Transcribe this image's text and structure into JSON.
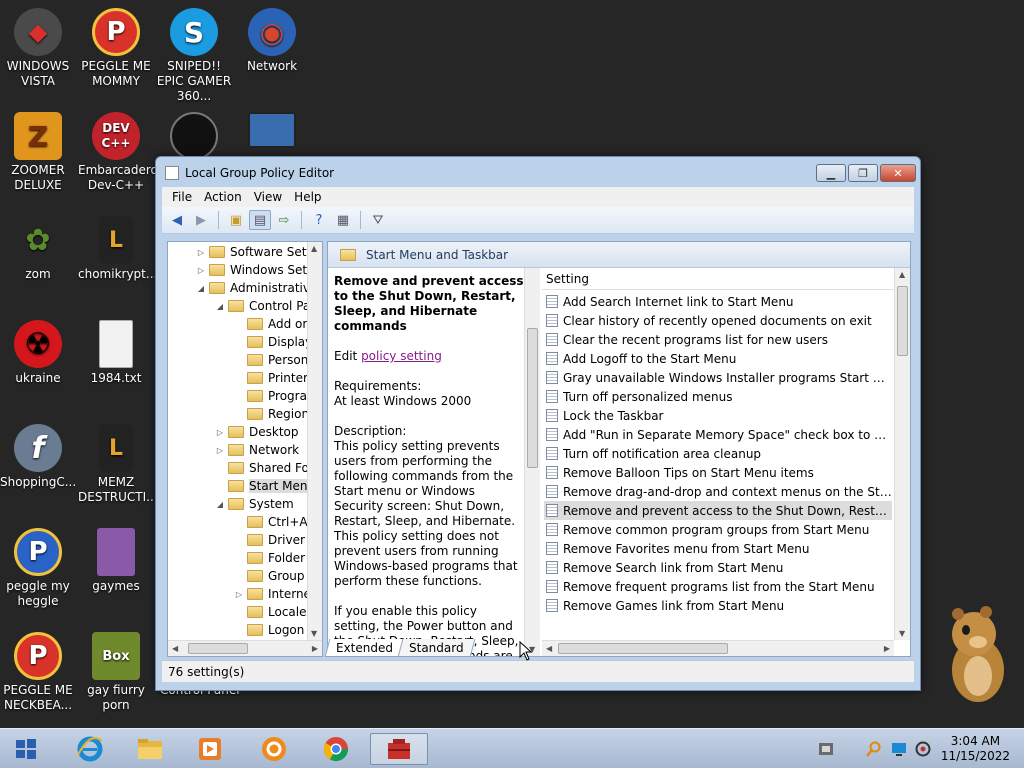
{
  "desktop": {
    "icons": [
      {
        "label": "WINDOWS VISTA",
        "icon": "windows-vista-icon",
        "color": "#4a4a4a"
      },
      {
        "label": "PEGGLE ME MOMMY",
        "icon": "peggle-icon",
        "color": "#d9322a"
      },
      {
        "label": "SNIPED!! EPIC GAMER 360...",
        "icon": "skype-icon",
        "color": "#1b9be0"
      },
      {
        "label": "Network",
        "icon": "network-icon",
        "color": "#2a63b5"
      },
      {
        "label": "ZOOMER DELUXE",
        "icon": "zoomer-icon",
        "color": "#e0951c"
      },
      {
        "label": "Embarcadero Dev-C++",
        "icon": "devcpp-icon",
        "color": "#c2222a"
      },
      {
        "label": "",
        "icon": "dark-circle-icon",
        "color": "#111111"
      },
      {
        "label": "",
        "icon": "monitor-icon",
        "color": "#3a6cb0"
      },
      {
        "label": "zom",
        "icon": "flower-icon",
        "color": "#e8e8e8"
      },
      {
        "label": "chomikrypt...",
        "icon": "chomikrypt-icon",
        "color": "#222222"
      },
      {
        "label": "ukraine",
        "icon": "radiation-icon",
        "color": "#d4161d"
      },
      {
        "label": "1984.txt",
        "icon": "text-file-icon",
        "color": "#f2f2f2"
      },
      {
        "label": "ShoppingC...",
        "icon": "flash-icon",
        "color": "#6a7c92"
      },
      {
        "label": "MEMZ DESTRUCTI...",
        "icon": "memz-icon",
        "color": "#222222"
      },
      {
        "label": "peggle my heggle",
        "icon": "peggle-icon",
        "color": "#2a62c7"
      },
      {
        "label": "gaymes",
        "icon": "gaymes-icon",
        "color": "#8a5aa8"
      },
      {
        "label": "PEGGLE ME NECKBEA...",
        "icon": "peggle-icon",
        "color": "#d9322a"
      },
      {
        "label": "gay fiurry porn",
        "icon": "box-icon",
        "color": "#6f8a2d"
      }
    ],
    "box_text": "Box",
    "devcpp_text": "DEV C++",
    "behind_window_text": "Control Panel"
  },
  "window": {
    "title": "Local Group Policy Editor",
    "menu": [
      "File",
      "Action",
      "View",
      "Help"
    ],
    "tree": [
      {
        "label": "Software Setti",
        "level": 1,
        "expander": "▷"
      },
      {
        "label": "Windows Sett",
        "level": 1,
        "expander": "▷"
      },
      {
        "label": "Administrativ",
        "level": 1,
        "expander": "◢"
      },
      {
        "label": "Control Pa",
        "level": 2,
        "expander": "◢"
      },
      {
        "label": "Add or",
        "level": 3,
        "expander": ""
      },
      {
        "label": "Display",
        "level": 3,
        "expander": ""
      },
      {
        "label": "Person",
        "level": 3,
        "expander": ""
      },
      {
        "label": "Printer",
        "level": 3,
        "expander": ""
      },
      {
        "label": "Progra",
        "level": 3,
        "expander": ""
      },
      {
        "label": "Region",
        "level": 3,
        "expander": ""
      },
      {
        "label": "Desktop",
        "level": 2,
        "expander": "▷"
      },
      {
        "label": "Network",
        "level": 2,
        "expander": "▷"
      },
      {
        "label": "Shared Fol",
        "level": 2,
        "expander": ""
      },
      {
        "label": "Start Menu",
        "level": 2,
        "expander": "",
        "selected": true
      },
      {
        "label": "System",
        "level": 2,
        "expander": "◢"
      },
      {
        "label": "Ctrl+A",
        "level": 3,
        "expander": ""
      },
      {
        "label": "Driver I",
        "level": 3,
        "expander": ""
      },
      {
        "label": "Folder",
        "level": 3,
        "expander": ""
      },
      {
        "label": "Group",
        "level": 3,
        "expander": ""
      },
      {
        "label": "Interne",
        "level": 3,
        "expander": "▷"
      },
      {
        "label": "Locale",
        "level": 3,
        "expander": ""
      },
      {
        "label": "Logon",
        "level": 3,
        "expander": ""
      }
    ],
    "pane_header": "Start Menu and Taskbar",
    "description": {
      "title": "Remove and prevent access to the Shut Down, Restart, Sleep, and Hibernate commands",
      "edit_prefix": "Edit ",
      "edit_link": "policy setting",
      "requirements_label": "Requirements:",
      "requirements_value": "At least Windows 2000",
      "description_label": "Description:",
      "description_text": "This policy setting prevents users from performing the following commands from the Start menu or Windows Security screen: Shut Down, Restart, Sleep, and Hibernate. This policy setting does not prevent users from running Windows-based programs that perform these functions.",
      "enable_text": "If you enable this policy setting, the Power button and the Shut Down, Restart, Sleep, and Hibernate commands are"
    },
    "list_header": "Setting",
    "settings": [
      "Add Search Internet link to Start Menu",
      "Clear history of recently opened documents on exit",
      "Clear the recent programs list for new users",
      "Add Logoff to the Start Menu",
      "Gray unavailable Windows Installer programs Start Menu sh...",
      "Turn off personalized menus",
      "Lock the Taskbar",
      "Add \"Run in Separate Memory Space\" check box to Run dial...",
      "Turn off notification area cleanup",
      "Remove Balloon Tips on Start Menu items",
      "Remove drag-and-drop and context menus on the Start Me...",
      "Remove and prevent access to the Shut Down, Restart, Sleep...",
      "Remove common program groups from Start Menu",
      "Remove Favorites menu from Start Menu",
      "Remove Search link from Start Menu",
      "Remove frequent programs list from the Start Menu",
      "Remove Games link from Start Menu"
    ],
    "selected_setting_index": 11,
    "tabs": [
      "Extended",
      "Standard"
    ],
    "status": "76 setting(s)"
  },
  "taskbar": {
    "items": [
      "start-icon",
      "internet-explorer-icon",
      "file-explorer-icon",
      "media-player-icon",
      "orange-app-icon",
      "chrome-icon",
      "group-policy-icon"
    ],
    "active_index": 6,
    "time": "3:04 AM",
    "date": "11/15/2022"
  },
  "colors": {
    "accent": "#2c64b3",
    "selection": "#dcdcdc",
    "link": "#8b1a8b"
  }
}
